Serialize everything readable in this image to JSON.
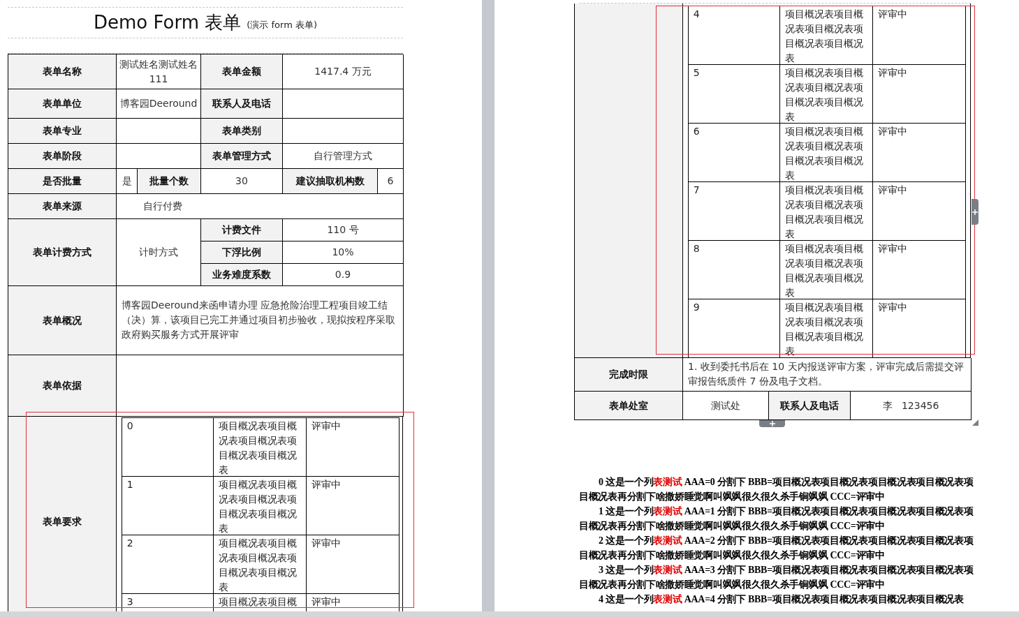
{
  "page_1": {
    "title": "Demo Form 表单",
    "title_note": "(演示 form 表单)",
    "rows": [
      {
        "kind": "pair",
        "cells": [
          {
            "kind": "label",
            "text": "表单名称"
          },
          {
            "kind": "value",
            "text": "测试姓名测试姓名 111"
          },
          {
            "kind": "label",
            "text": "表单金额"
          },
          {
            "kind": "value",
            "text": "1417.4 万元"
          }
        ]
      },
      {
        "kind": "pair",
        "cells": [
          {
            "kind": "label",
            "text": "表单单位"
          },
          {
            "kind": "value",
            "text": "博客园Deeround"
          },
          {
            "kind": "label",
            "text": "联系人及电话"
          },
          {
            "kind": "value"
          }
        ]
      },
      {
        "kind": "pair",
        "cells": [
          {
            "kind": "label",
            "text": "表单专业"
          },
          {
            "kind": "value"
          },
          {
            "kind": "label",
            "text": "表单类别"
          },
          {
            "kind": "value"
          }
        ]
      },
      {
        "kind": "pair",
        "cells": [
          {
            "kind": "label",
            "text": "表单阶段"
          },
          {
            "kind": "value"
          },
          {
            "kind": "label",
            "text": "表单管理方式"
          },
          {
            "kind": "value",
            "text": "自行管理方式"
          }
        ]
      },
      {
        "kind": "batch",
        "cells": [
          {
            "kind": "label",
            "text": "是否批量"
          },
          {
            "kind": "split",
            "parts": [
              {
                "kind": "value",
                "text": "是"
              },
              {
                "kind": "label",
                "text": "批量个数"
              }
            ]
          },
          {
            "kind": "value",
            "text": "30"
          },
          {
            "kind": "split",
            "parts": [
              {
                "kind": "label",
                "text": "建议抽取机构数"
              },
              {
                "kind": "value",
                "text": "6"
              }
            ]
          }
        ]
      },
      {
        "kind": "wide",
        "cells": [
          {
            "kind": "label",
            "text": "表单来源"
          },
          {
            "kind": "value",
            "text": "自行付费"
          }
        ]
      },
      {
        "kind": "fee",
        "cells": [
          {
            "kind": "label",
            "text": "表单计费方式"
          },
          {
            "kind": "value",
            "text": "计时方式"
          }
        ],
        "sub_rows": [
          {
            "label": "计费文件",
            "value": "110 号"
          },
          {
            "label": "下浮比例",
            "value": "10%"
          },
          {
            "label": "业务难度系数",
            "value": "0.9"
          }
        ]
      },
      {
        "kind": "text",
        "cells": [
          {
            "kind": "label",
            "text": "表单概况"
          },
          {
            "kind": "value",
            "text": "博客园Deeround来函申请办理  应急抢险治理工程项目竣工结（决）算，该项目已完工并通过项目初步验收，现拟按程序采取政府购买服务方式开展评审"
          }
        ]
      },
      {
        "kind": "text",
        "cells": [
          {
            "kind": "label",
            "text": "表单依据"
          }
        ]
      }
    ],
    "requirements": {
      "label": "表单要求",
      "items": [
        {
          "number": "0",
          "description": "项目概况表项目概况表项目概况表项目概况表项目概况表",
          "status": "评审中"
        },
        {
          "number": "1",
          "description": "项目概况表项目概况表项目概况表项目概况表项目概况表",
          "status": "评审中"
        },
        {
          "number": "2",
          "description": "项目概况表项目概况表项目概况表项目概况表项目概况表",
          "status": "评审中"
        },
        {
          "number": "3",
          "description": "项目概况表项目概",
          "status": "评审中"
        }
      ]
    }
  },
  "page_2": {
    "requirement_items": [
      {
        "number": "4",
        "description": "项目概况表项目概况表项目概况表项目概况表项目概况表",
        "status": "评审中"
      },
      {
        "number": "5",
        "description": "项目概况表项目概况表项目概况表项目概况表项目概况表",
        "status": "评审中"
      },
      {
        "number": "6",
        "description": "项目概况表项目概况表项目概况表项目概况表项目概况表",
        "status": "评审中"
      },
      {
        "number": "7",
        "description": "项目概况表项目概况表项目概况表项目概况表项目概况表",
        "status": "评审中"
      },
      {
        "number": "8",
        "description": "项目概况表项目概况表项目概况表项目概况表项目概况表",
        "status": "评审中"
      },
      {
        "number": "9",
        "description": "项目概况表项目概况表项目概况表项目概况表项目概况表",
        "status": "评审中"
      }
    ],
    "deadline": {
      "label": "完成时限",
      "text": "1. 收到委托书后在 10 天内报送评审方案，评审完成后需提交评审报告纸质件 7 份及电子文档。"
    },
    "office": {
      "label": "表单处室",
      "value": "测试处",
      "contact_label": "联系人及电话",
      "contact_value": "李   123456"
    },
    "paragraphs": [
      {
        "lead": "0 这是一个列",
        "highlight": "表测试",
        "rest": " AAA=0 分割下 BBB=项目概况表项目概况表项目概况表项目概况表项目概况表再分割下啥撒娇睡觉啊叫飒飒很久很久杀手锏飒飒 CCC=评审中"
      },
      {
        "lead": "1 这是一个列",
        "highlight": "表测试",
        "rest": " AAA=1 分割下 BBB=项目概况表项目概况表项目概况表项目概况表项目概况表再分割下啥撒娇睡觉啊叫飒飒很久很久杀手锏飒飒 CCC=评审中"
      },
      {
        "lead": "2 这是一个列",
        "highlight": "表测试",
        "rest": " AAA=2 分割下 BBB=项目概况表项目概况表项目概况表项目概况表项目概况表再分割下啥撒娇睡觉啊叫飒飒很久很久杀手锏飒飒 CCC=评审中"
      },
      {
        "lead": "3 这是一个列",
        "highlight": "表测试",
        "rest": " AAA=3 分割下 BBB=项目概况表项目概况表项目概况表项目概况表项目概况表再分割下啥撒娇睡觉啊叫飒飒很久很久杀手锏飒飒 CCC=评审中"
      },
      {
        "lead": "4 这是一个列",
        "highlight": "表测试",
        "rest": " AAA=4 分割下 BBB=项目概况表项目概况表项目概况表项目概况表"
      }
    ]
  }
}
